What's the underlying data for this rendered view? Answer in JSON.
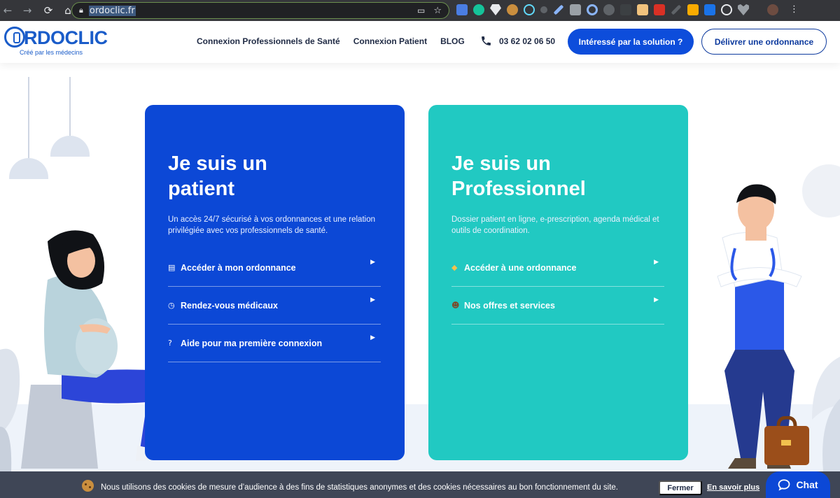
{
  "browser": {
    "url": "ordoclic.fr"
  },
  "header": {
    "logo_name": "RDOCLIC",
    "logo_tagline": "Créé par les médecins",
    "nav": [
      {
        "label": "Connexion Professionnels de Santé"
      },
      {
        "label": "Connexion Patient"
      },
      {
        "label": "BLOG"
      }
    ],
    "phone": "03 62 02 06 50",
    "cta_primary": "Intéressé par la solution ?",
    "cta_secondary": "Délivrer une ordonnance"
  },
  "patient_card": {
    "title_line1": "Je suis un",
    "title_line2": "patient",
    "description": "Un accès 24/7 sécurisé à vos ordonnances et une relation privilégiée avec vos professionnels de santé.",
    "items": [
      {
        "icon": "document-icon",
        "glyph": "▤",
        "label": "Accéder à mon ordonnance"
      },
      {
        "icon": "clock-icon",
        "glyph": "◷",
        "label": "Rendez-vous médicaux"
      },
      {
        "icon": "question-icon",
        "glyph": "?",
        "label": "Aide pour ma première connexion"
      }
    ],
    "color": "#0c48d6"
  },
  "pro_card": {
    "title_line1": "Je suis un",
    "title_line2": "Professionnel",
    "description": "Dossier patient en ligne, e-prescription, agenda médical et outils de coordination.",
    "items": [
      {
        "icon": "pill-icon",
        "glyph": "◆",
        "label": "Accéder à une ordonnance"
      },
      {
        "icon": "doctor-icon",
        "glyph": "☻",
        "label": "Nos offres et services"
      }
    ],
    "color": "#21c9c2"
  },
  "cookie": {
    "text": "Nous utilisons des cookies de mesure d’audience à des fins de statistiques anonymes et des cookies nécessaires au bon fonctionnement du site.",
    "close_label": "Fermer",
    "more_label": "En savoir plus"
  },
  "chat": {
    "label": "Chat"
  }
}
